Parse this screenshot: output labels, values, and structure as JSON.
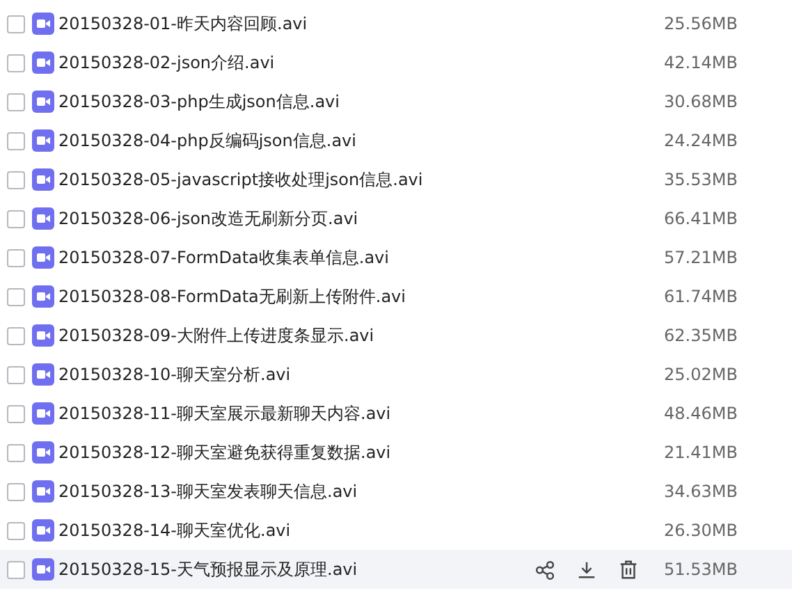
{
  "files": [
    {
      "name": "20150328-01-昨天内容回顾.avi",
      "size": "25.56MB",
      "checked": false,
      "hovered": false
    },
    {
      "name": "20150328-02-json介绍.avi",
      "size": "42.14MB",
      "checked": false,
      "hovered": false
    },
    {
      "name": "20150328-03-php生成json信息.avi",
      "size": "30.68MB",
      "checked": false,
      "hovered": false
    },
    {
      "name": "20150328-04-php反编码json信息.avi",
      "size": "24.24MB",
      "checked": false,
      "hovered": false
    },
    {
      "name": "20150328-05-javascript接收处理json信息.avi",
      "size": "35.53MB",
      "checked": false,
      "hovered": false
    },
    {
      "name": "20150328-06-json改造无刷新分页.avi",
      "size": "66.41MB",
      "checked": false,
      "hovered": false
    },
    {
      "name": "20150328-07-FormData收集表单信息.avi",
      "size": "57.21MB",
      "checked": false,
      "hovered": false
    },
    {
      "name": "20150328-08-FormData无刷新上传附件.avi",
      "size": "61.74MB",
      "checked": false,
      "hovered": false
    },
    {
      "name": "20150328-09-大附件上传进度条显示.avi",
      "size": "62.35MB",
      "checked": false,
      "hovered": false
    },
    {
      "name": "20150328-10-聊天室分析.avi",
      "size": "25.02MB",
      "checked": false,
      "hovered": false
    },
    {
      "name": "20150328-11-聊天室展示最新聊天内容.avi",
      "size": "48.46MB",
      "checked": false,
      "hovered": false
    },
    {
      "name": "20150328-12-聊天室避免获得重复数据.avi",
      "size": "21.41MB",
      "checked": false,
      "hovered": false
    },
    {
      "name": "20150328-13-聊天室发表聊天信息.avi",
      "size": "34.63MB",
      "checked": false,
      "hovered": false
    },
    {
      "name": "20150328-14-聊天室优化.avi",
      "size": "26.30MB",
      "checked": false,
      "hovered": false
    },
    {
      "name": "20150328-15-天气预报显示及原理.avi",
      "size": "51.53MB",
      "checked": false,
      "hovered": true
    }
  ]
}
